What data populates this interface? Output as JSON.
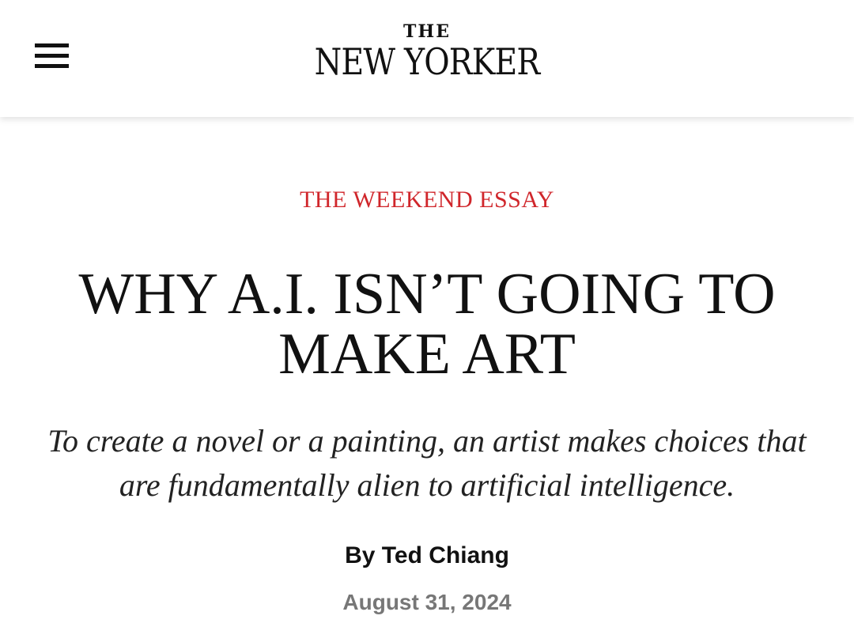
{
  "header": {
    "menu_icon": "hamburger-menu-icon",
    "logo": {
      "the": "THE",
      "name": "NEW YORKER"
    }
  },
  "article": {
    "rubric": "THE WEEKEND ESSAY",
    "headline": "WHY A.I. ISN’T GOING TO MAKE ART",
    "dek": "To create a novel or a painting, an artist makes choices that are fundamentally alien to artificial intelligence.",
    "byline": {
      "prefix": "By",
      "author": "Ted Chiang"
    },
    "date": "August 31, 2024"
  },
  "colors": {
    "rubric": "#d0262b",
    "text": "#111111",
    "date": "#777777",
    "background": "#ffffff"
  }
}
